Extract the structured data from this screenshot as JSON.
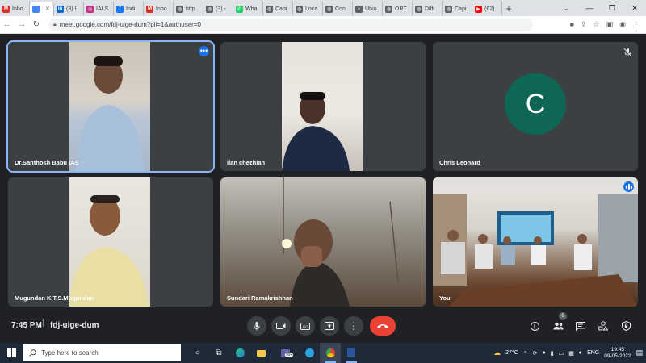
{
  "browser": {
    "tabs": [
      {
        "label": "Inbo",
        "icon": "gmail-icon",
        "color": "#d93025"
      },
      {
        "label": "",
        "icon": "chrome-icon",
        "color": "#4285f4",
        "active": true
      },
      {
        "label": "(3) L",
        "icon": "linkedin-icon",
        "color": "#0a66c2"
      },
      {
        "label": "IALS",
        "icon": "instagram-icon",
        "color": "#c13584"
      },
      {
        "label": "Indi",
        "icon": "facebook-icon",
        "color": "#1877f2"
      },
      {
        "label": "Inbo",
        "icon": "gmail-icon",
        "color": "#d93025"
      },
      {
        "label": "http",
        "icon": "globe-icon",
        "color": "#5f6368"
      },
      {
        "label": "(3) -",
        "icon": "globe-icon",
        "color": "#5f6368"
      },
      {
        "label": "Wha",
        "icon": "whatsapp-icon",
        "color": "#25d366"
      },
      {
        "label": "Capi",
        "icon": "globe-icon",
        "color": "#5f6368"
      },
      {
        "label": "Loca",
        "icon": "globe-icon",
        "color": "#5f6368"
      },
      {
        "label": "Con",
        "icon": "globe-icon",
        "color": "#5f6368"
      },
      {
        "label": "Utko",
        "icon": "home-icon",
        "color": "#5f6368"
      },
      {
        "label": "ORT",
        "icon": "globe-icon",
        "color": "#5f6368"
      },
      {
        "label": "Diffi",
        "icon": "globe-icon",
        "color": "#5f6368"
      },
      {
        "label": "Capi",
        "icon": "globe-icon",
        "color": "#5f6368"
      },
      {
        "label": "(62)",
        "icon": "youtube-icon",
        "color": "#ff0000"
      }
    ],
    "url": "meet.google.com/fdj-uige-dum?pli=1&authuser=0"
  },
  "participants": [
    {
      "name": "Dr.Santhosh Babu IAS",
      "speaking": true
    },
    {
      "name": "ilan chezhian"
    },
    {
      "name": "Chris Leonard",
      "initial": "C",
      "muted": true,
      "avatar_color": "#0e6655"
    },
    {
      "name": "Mugundan K.T.S.Mugundan"
    },
    {
      "name": "Sundari Ramakrishnan"
    },
    {
      "name": "You"
    }
  ],
  "meeting": {
    "time": "7:45 PM",
    "separator": "|",
    "code": "fdj-uige-dum",
    "participant_count": "6"
  },
  "taskbar": {
    "search_placeholder": "Type here to search",
    "weather": "27°C",
    "language": "ENG",
    "time": "19:45",
    "date": "09-05-2022",
    "teams_badge": "99+"
  }
}
